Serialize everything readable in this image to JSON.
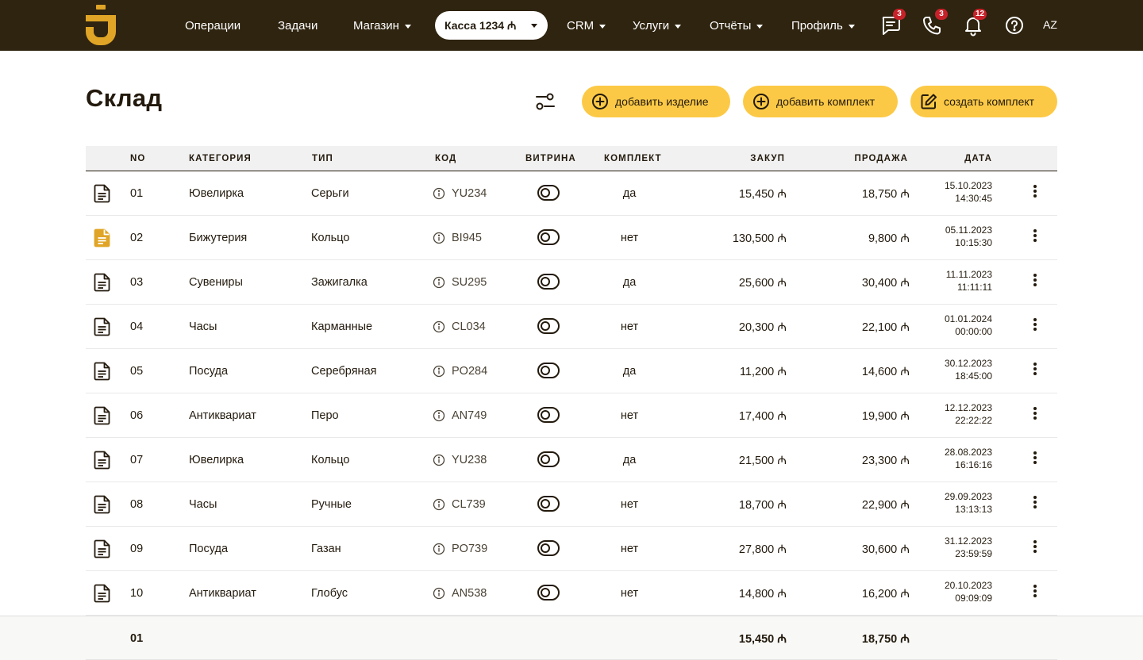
{
  "nav": {
    "items": [
      {
        "label": "Операции",
        "dropdown": false
      },
      {
        "label": "Задачи",
        "dropdown": false
      },
      {
        "label": "Магазин",
        "dropdown": true
      },
      {
        "label": "CRM",
        "dropdown": true
      },
      {
        "label": "Услуги",
        "dropdown": true
      },
      {
        "label": "Отчёты",
        "dropdown": true
      },
      {
        "label": "Профиль",
        "dropdown": true
      }
    ],
    "register": "Касса 1234 ₼",
    "badges": {
      "messages": "3",
      "calls": "3",
      "notifications": "12"
    },
    "language": "AZ"
  },
  "page": {
    "title": "Склад",
    "buttons": {
      "add_item": "добавить изделие",
      "add_set": "добавить комплект",
      "create_set": "создать комплект"
    }
  },
  "table": {
    "headers": {
      "no": "NO",
      "category": "КАТЕГОРИЯ",
      "type": "ТИП",
      "code": "КОД",
      "showcase": "ВИТРИНА",
      "set": "КОМПЛЕКТ",
      "purchase": "ЗАКУП",
      "sale": "ПРОДАЖА",
      "date": "ДАТА"
    },
    "rows": [
      {
        "no": "01",
        "category": "Ювелирка",
        "type": "Серьги",
        "code": "YU234",
        "set": "да",
        "purchase": "15,450 ₼",
        "sale": "18,750 ₼",
        "date": "15.10.2023",
        "time": "14:30:45",
        "highlighted": false,
        "showcase": false
      },
      {
        "no": "02",
        "category": "Бижутерия",
        "type": "Кольцо",
        "code": "BI945",
        "set": "нет",
        "purchase": "130,500 ₼",
        "sale": "9,800 ₼",
        "date": "05.11.2023",
        "time": "10:15:30",
        "highlighted": true,
        "showcase": false
      },
      {
        "no": "03",
        "category": "Сувениры",
        "type": "Зажигалка",
        "code": "SU295",
        "set": "да",
        "purchase": "25,600 ₼",
        "sale": "30,400 ₼",
        "date": "11.11.2023",
        "time": "11:11:11",
        "highlighted": false,
        "showcase": false
      },
      {
        "no": "04",
        "category": "Часы",
        "type": "Карманные",
        "code": "CL034",
        "set": "нет",
        "purchase": "20,300 ₼",
        "sale": "22,100 ₼",
        "date": "01.01.2024",
        "time": "00:00:00",
        "highlighted": false,
        "showcase": false
      },
      {
        "no": "05",
        "category": "Посуда",
        "type": "Серебряная",
        "code": "PO284",
        "set": "да",
        "purchase": "11,200 ₼",
        "sale": "14,600 ₼",
        "date": "30.12.2023",
        "time": "18:45:00",
        "highlighted": false,
        "showcase": false
      },
      {
        "no": "06",
        "category": "Антиквариат",
        "type": "Перо",
        "code": "AN749",
        "set": "нет",
        "purchase": "17,400 ₼",
        "sale": "19,900 ₼",
        "date": "12.12.2023",
        "time": "22:22:22",
        "highlighted": false,
        "showcase": false
      },
      {
        "no": "07",
        "category": "Ювелирка",
        "type": "Кольцо",
        "code": "YU238",
        "set": "да",
        "purchase": "21,500 ₼",
        "sale": "23,300 ₼",
        "date": "28.08.2023",
        "time": "16:16:16",
        "highlighted": false,
        "showcase": false
      },
      {
        "no": "08",
        "category": "Часы",
        "type": "Ручные",
        "code": "CL739",
        "set": "нет",
        "purchase": "18,700 ₼",
        "sale": "22,900 ₼",
        "date": "29.09.2023",
        "time": "13:13:13",
        "highlighted": false,
        "showcase": false
      },
      {
        "no": "09",
        "category": "Посуда",
        "type": "Газан",
        "code": "PO739",
        "set": "нет",
        "purchase": "27,800 ₼",
        "sale": "30,600 ₼",
        "date": "31.12.2023",
        "time": "23:59:59",
        "highlighted": false,
        "showcase": false
      },
      {
        "no": "10",
        "category": "Антиквариат",
        "type": "Глобус",
        "code": "AN538",
        "set": "нет",
        "purchase": "14,800 ₼",
        "sale": "16,200 ₼",
        "date": "20.10.2023",
        "time": "09:09:09",
        "highlighted": false,
        "showcase": false
      }
    ],
    "total": {
      "no": "01",
      "purchase": "15,450 ₼",
      "sale": "18,750 ₼"
    }
  },
  "colors": {
    "topbar": "#2f2410",
    "accent": "#fcc946",
    "logo": "#e0a526",
    "badge": "#c7222a",
    "text": "#231a0d"
  },
  "icons": [
    "logo-icon",
    "chat-icon",
    "phone-icon",
    "bell-icon",
    "help-icon",
    "filter-icon",
    "plus-circle-icon",
    "edit-icon",
    "document-icon",
    "info-icon",
    "more-vertical-icon"
  ]
}
